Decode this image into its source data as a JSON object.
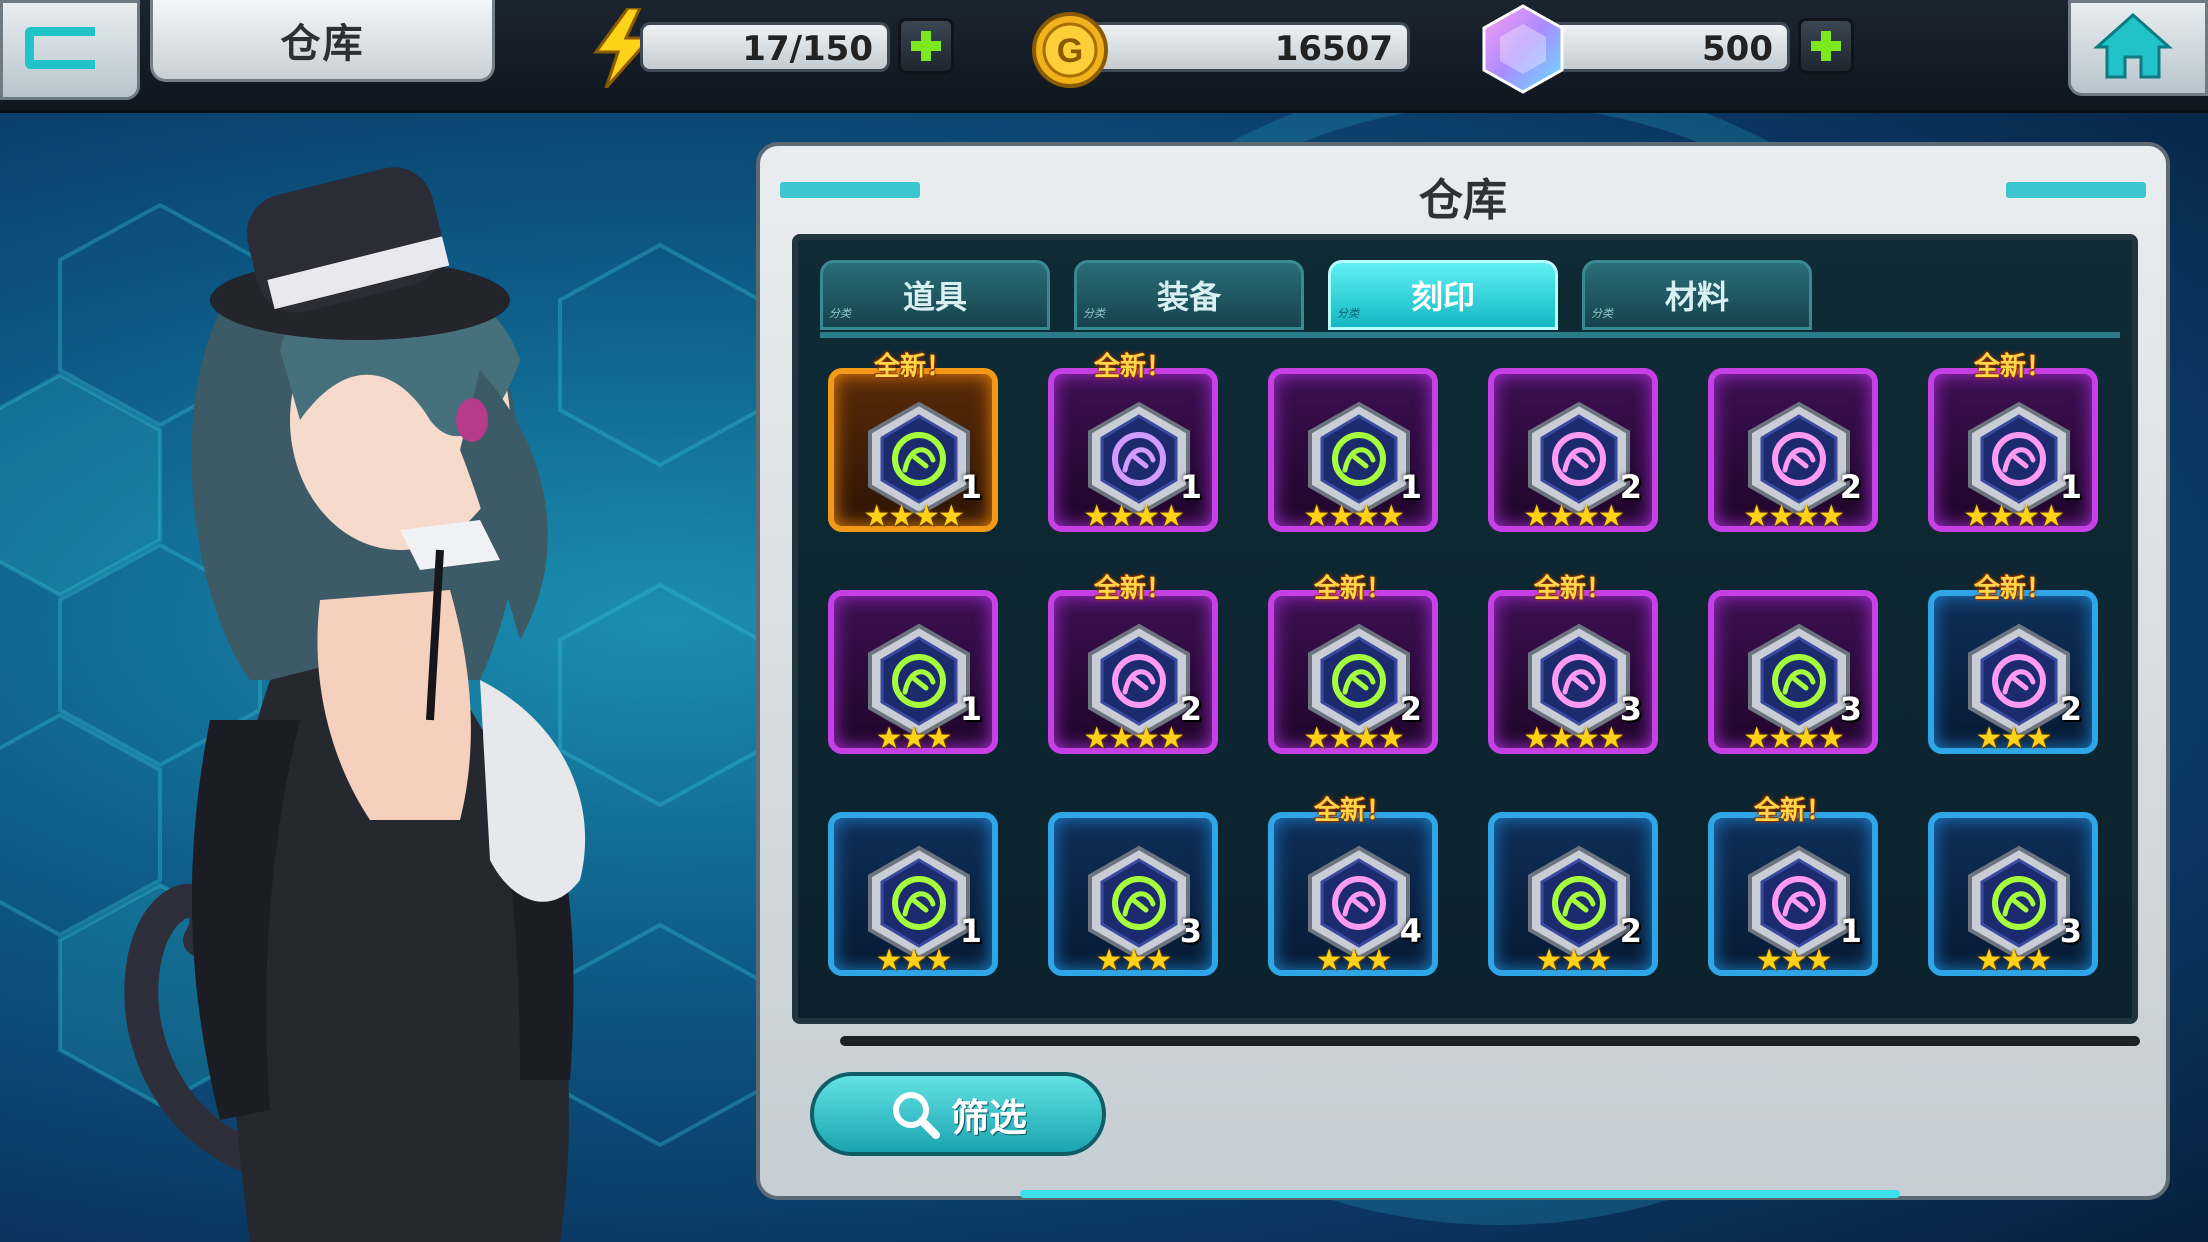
{
  "header": {
    "title": "仓库",
    "energy": "17/150",
    "gold": "16507",
    "gems": "500"
  },
  "panel": {
    "title": "仓库",
    "tabs": [
      {
        "label": "道具",
        "active": false
      },
      {
        "label": "装备",
        "active": false
      },
      {
        "label": "刻印",
        "active": true
      },
      {
        "label": "材料",
        "active": false
      }
    ],
    "tab_mini_label": "分类",
    "new_tag": "全新！",
    "filter_label": "筛选"
  },
  "items": [
    {
      "frame": "orange",
      "icon": "flame-swirl-icon",
      "count": "1",
      "stars": 4,
      "is_new": true,
      "glow": "#a6ff3c"
    },
    {
      "frame": "purple",
      "icon": "crystal-burst-icon",
      "count": "1",
      "stars": 4,
      "is_new": true,
      "glow": "#d39bff"
    },
    {
      "frame": "purple",
      "icon": "crystal-burst-icon",
      "count": "1",
      "stars": 4,
      "is_new": false,
      "glow": "#a6ff3c"
    },
    {
      "frame": "purple",
      "icon": "lotus-flower-icon",
      "count": "2",
      "stars": 4,
      "is_new": false,
      "glow": "#ff9bf2"
    },
    {
      "frame": "purple",
      "icon": "honeycomb-icon",
      "count": "2",
      "stars": 4,
      "is_new": false,
      "glow": "#ff9bf2"
    },
    {
      "frame": "purple",
      "icon": "phoenix-wing-icon",
      "count": "1",
      "stars": 4,
      "is_new": true,
      "glow": "#ff9bf2"
    },
    {
      "frame": "purple",
      "icon": "leaf-vine-icon",
      "count": "1",
      "stars": 3,
      "is_new": false,
      "glow": "#a6ff3c"
    },
    {
      "frame": "purple",
      "icon": "tribal-flame-icon",
      "count": "2",
      "stars": 4,
      "is_new": true,
      "glow": "#ff9bf2"
    },
    {
      "frame": "purple",
      "icon": "tribal-flame-icon",
      "count": "2",
      "stars": 4,
      "is_new": true,
      "glow": "#a6ff3c"
    },
    {
      "frame": "purple",
      "icon": "tentacle-flame-icon",
      "count": "3",
      "stars": 4,
      "is_new": true,
      "glow": "#ff9bf2"
    },
    {
      "frame": "purple",
      "icon": "tentacle-flame-icon",
      "count": "3",
      "stars": 4,
      "is_new": false,
      "glow": "#a6ff3c"
    },
    {
      "frame": "blue",
      "icon": "wind-claw-icon",
      "count": "2",
      "stars": 3,
      "is_new": true,
      "glow": "#ff9bf2"
    },
    {
      "frame": "blue",
      "icon": "wind-claw-icon",
      "count": "1",
      "stars": 3,
      "is_new": false,
      "glow": "#a6ff3c"
    },
    {
      "frame": "blue",
      "icon": "wind-claw-icon",
      "count": "3",
      "stars": 3,
      "is_new": false,
      "glow": "#a6ff3c"
    },
    {
      "frame": "blue",
      "icon": "paw-print-icon",
      "count": "4",
      "stars": 3,
      "is_new": true,
      "glow": "#ff9bf2"
    },
    {
      "frame": "blue",
      "icon": "paw-print-icon",
      "count": "2",
      "stars": 3,
      "is_new": false,
      "glow": "#a6ff3c"
    },
    {
      "frame": "blue",
      "icon": "pixel-star-icon",
      "count": "1",
      "stars": 3,
      "is_new": true,
      "glow": "#ff9bf2"
    },
    {
      "frame": "blue",
      "icon": "pixel-star-icon",
      "count": "3",
      "stars": 3,
      "is_new": false,
      "glow": "#a6ff3c"
    }
  ],
  "colors": {
    "accent": "#3cc6cf",
    "star": "#ffd21a",
    "plus": "#7ee81e"
  }
}
